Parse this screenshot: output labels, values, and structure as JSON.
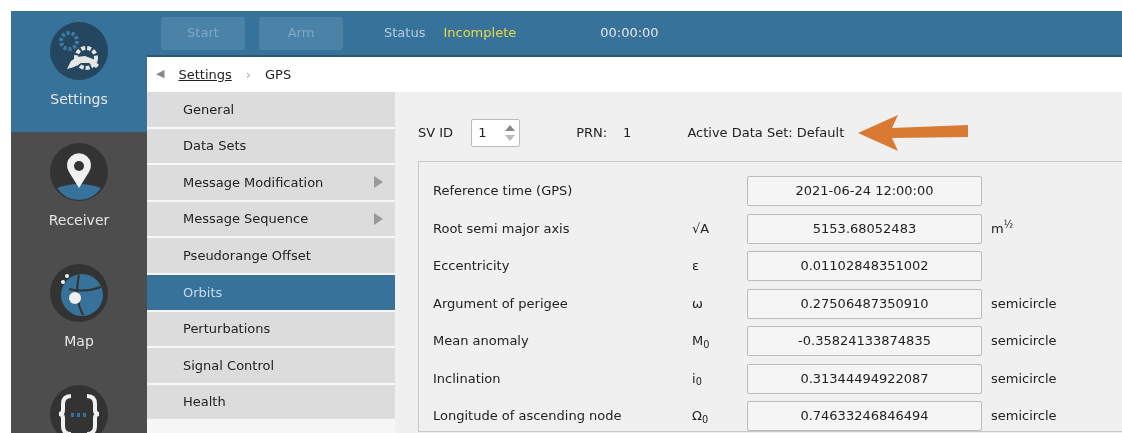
{
  "nav_rail": [
    {
      "kind": "settings",
      "label": "Settings",
      "selected": true
    },
    {
      "kind": "receiver",
      "label": "Receiver",
      "selected": false
    },
    {
      "kind": "map",
      "label": "Map",
      "selected": false
    },
    {
      "kind": "script",
      "selected": false
    }
  ],
  "toolbar": {
    "buttons": [
      {
        "label": "Start",
        "disabled": true
      },
      {
        "label": "Arm",
        "disabled": true
      }
    ],
    "status_label": "Status",
    "status_value": "Incomplete",
    "elapsed": "00:00:00"
  },
  "breadcrumb": {
    "back": "◀",
    "items": [
      "Settings",
      "GPS"
    ],
    "separator": "›"
  },
  "menu": [
    {
      "label": "General",
      "selected": false,
      "has_submenu": false
    },
    {
      "label": "Data Sets",
      "selected": false,
      "has_submenu": false
    },
    {
      "label": "Message Modification",
      "selected": false,
      "has_submenu": true
    },
    {
      "label": "Message Sequence",
      "selected": false,
      "has_submenu": true
    },
    {
      "label": "Pseudorange Offset",
      "selected": false,
      "has_submenu": false
    },
    {
      "label": "Orbits",
      "selected": true,
      "has_submenu": false
    },
    {
      "label": "Perturbations",
      "selected": false,
      "has_submenu": false
    },
    {
      "label": "Signal Control",
      "selected": false,
      "has_submenu": false
    },
    {
      "label": "Health",
      "selected": false,
      "has_submenu": false
    }
  ],
  "header": {
    "sv_id_label": "SV ID",
    "sv_id": "1",
    "prn_label": "PRN:",
    "prn": "1",
    "active_data_set": "Active Data Set: Default"
  },
  "parameters": [
    {
      "label": "Reference time (GPS)",
      "value": "2021-06-24 12:00:00"
    },
    {
      "label": "Root semi major axis",
      "symbol": "√A",
      "value": "5153.68052483",
      "unit": "m$^{½}$"
    },
    {
      "label": "Eccentricity",
      "symbol": "ε",
      "value": "0.01102848351002"
    },
    {
      "label": "Argument of perigee",
      "symbol": "ω",
      "value": "0.27506487350910",
      "unit": "semicircle"
    },
    {
      "label": "Mean anomaly",
      "symbol": "M$_{0}$",
      "value": "-0.35824133874835",
      "unit": "semicircle"
    },
    {
      "label": "Inclination",
      "symbol": "i$_{0}$",
      "value": "0.31344494922087",
      "unit": "semicircle"
    },
    {
      "label": "Longitude of ascending node",
      "symbol": "Ω$_{0}$",
      "value": "0.74633246846494",
      "unit": "semicircle"
    }
  ]
}
